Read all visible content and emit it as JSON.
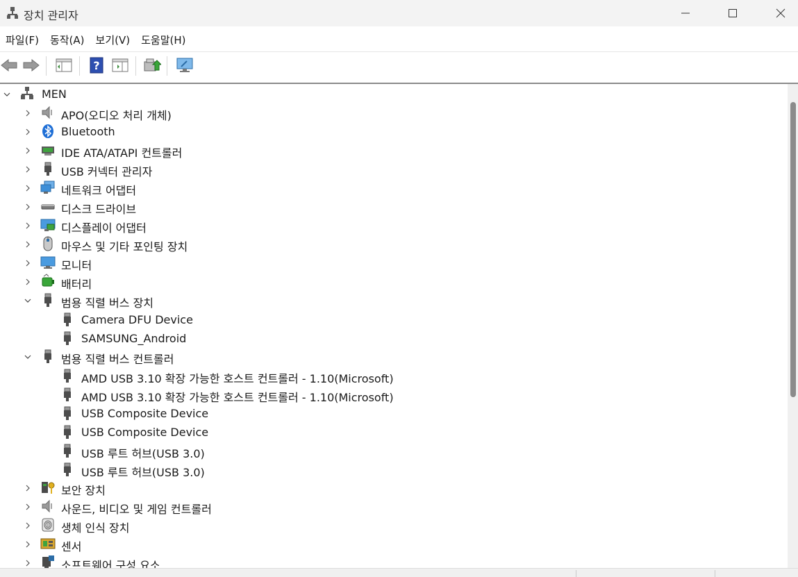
{
  "window": {
    "title": "장치 관리자"
  },
  "menu": [
    "파일(F)",
    "동작(A)",
    "보기(V)",
    "도움말(H)"
  ],
  "toolbar": {
    "buttons": [
      "back-icon",
      "forward-icon",
      "show-hide-console-tree-icon",
      "help-icon",
      "properties-pane-icon",
      "update-driver-icon",
      "scan-hardware-changes-icon"
    ]
  },
  "tree": {
    "root": "MEN",
    "items": [
      {
        "label": "APO(오디오 처리 개체)",
        "icon": "speaker-icon",
        "expanded": false
      },
      {
        "label": "Bluetooth",
        "icon": "bluetooth-icon",
        "expanded": false
      },
      {
        "label": "IDE ATA/ATAPI 컨트롤러",
        "icon": "ide-controller-icon",
        "expanded": false
      },
      {
        "label": "USB 커넥터 관리자",
        "icon": "usb-plug-icon",
        "expanded": false
      },
      {
        "label": "네트워크 어댑터",
        "icon": "network-adapter-icon",
        "expanded": false
      },
      {
        "label": "디스크 드라이브",
        "icon": "disk-drive-icon",
        "expanded": false
      },
      {
        "label": "디스플레이 어댑터",
        "icon": "display-adapter-icon",
        "expanded": false
      },
      {
        "label": "마우스 및 기타 포인팅 장치",
        "icon": "mouse-icon",
        "expanded": false
      },
      {
        "label": "모니터",
        "icon": "monitor-icon",
        "expanded": false
      },
      {
        "label": "배터리",
        "icon": "battery-icon",
        "expanded": false
      },
      {
        "label": "범용 직렬 버스 장치",
        "icon": "usb-plug-icon",
        "expanded": true,
        "children": [
          "Camera DFU Device",
          "SAMSUNG_Android"
        ]
      },
      {
        "label": "범용 직렬 버스 컨트롤러",
        "icon": "usb-plug-icon",
        "expanded": true,
        "children": [
          "AMD USB 3.10 확장 가능한 호스트 컨트롤러 - 1.10(Microsoft)",
          "AMD USB 3.10 확장 가능한 호스트 컨트롤러 - 1.10(Microsoft)",
          "USB Composite Device",
          "USB Composite Device",
          "USB 루트 허브(USB 3.0)",
          "USB 루트 허브(USB 3.0)"
        ]
      },
      {
        "label": "보안 장치",
        "icon": "security-device-icon",
        "expanded": false
      },
      {
        "label": "사운드, 비디오 및 게임 컨트롤러",
        "icon": "speaker-icon",
        "expanded": false
      },
      {
        "label": "생체 인식 장치",
        "icon": "fingerprint-icon",
        "expanded": false
      },
      {
        "label": "센서",
        "icon": "sensor-icon",
        "expanded": false
      },
      {
        "label": "소프트웨어 구성 요소",
        "icon": "software-component-icon",
        "expanded": false
      }
    ]
  }
}
